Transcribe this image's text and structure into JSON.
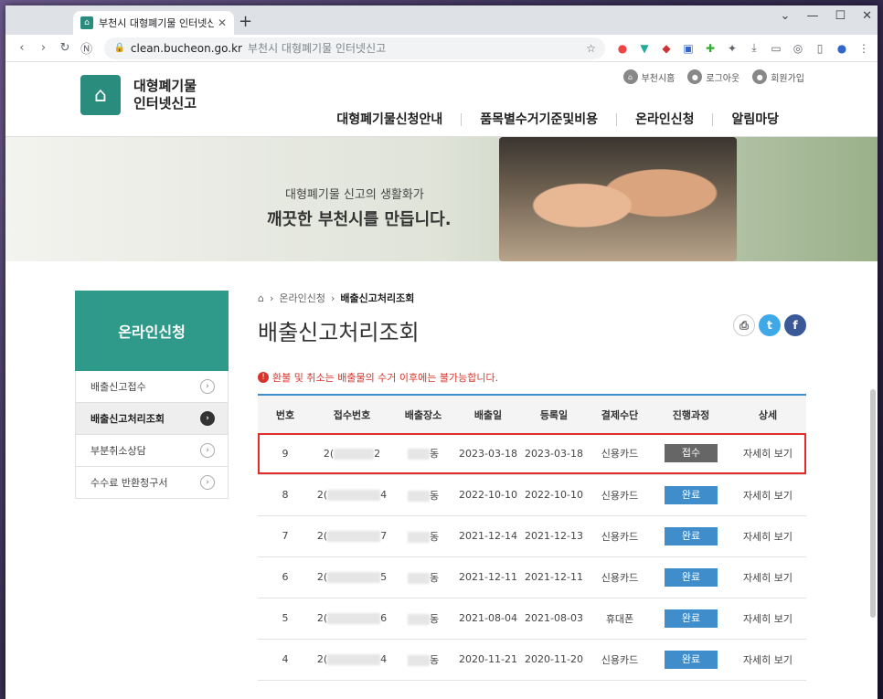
{
  "browser": {
    "tab_title": "부천시 대형폐기물 인터넷신고",
    "new_tab": "+",
    "url": "clean.bucheon.go.kr",
    "page_title": "부천시 대형폐기물 인터넷신고"
  },
  "site": {
    "logo_line1": "대형폐기물",
    "logo_line2": "인터넷신고",
    "util_links": [
      "부천시홈",
      "로그아웃",
      "회원가입"
    ],
    "gnb": [
      "대형폐기물신청안내",
      "품목별수거기준및비용",
      "온라인신청",
      "알림마당"
    ]
  },
  "banner": {
    "line1": "대형폐기물 신고의 생활화가",
    "line2": "깨끗한 부천시를 만듭니다."
  },
  "lnb": {
    "title": "온라인신청",
    "items": [
      "배출신고접수",
      "배출신고처리조회",
      "부분취소상담",
      "수수료 반환청구서"
    ]
  },
  "main": {
    "breadcrumb": [
      "온라인신청",
      "배출신고처리조회"
    ],
    "title": "배출신고처리조회",
    "notice": "환불 및 취소는 배출물의 수거 이후에는 불가능합니다.",
    "headers": [
      "번호",
      "접수번호",
      "배출장소",
      "배출일",
      "등록일",
      "결제수단",
      "진행과정",
      "상세"
    ],
    "rows": [
      {
        "no": "9",
        "rcpt_a": "2(",
        "rcpt_b": "2",
        "place": "동",
        "out": "2023-03-18",
        "reg": "2023-03-18",
        "pay": "신용카드",
        "status": "접수",
        "detail": "자세히 보기"
      },
      {
        "no": "8",
        "rcpt_a": "2(",
        "rcpt_b": "4",
        "place": "동",
        "out": "2022-10-10",
        "reg": "2022-10-10",
        "pay": "신용카드",
        "status": "완료",
        "detail": "자세히 보기"
      },
      {
        "no": "7",
        "rcpt_a": "2(",
        "rcpt_b": "7",
        "place": "동",
        "out": "2021-12-14",
        "reg": "2021-12-13",
        "pay": "신용카드",
        "status": "완료",
        "detail": "자세히 보기"
      },
      {
        "no": "6",
        "rcpt_a": "2(",
        "rcpt_b": "5",
        "place": "동",
        "out": "2021-12-11",
        "reg": "2021-12-11",
        "pay": "신용카드",
        "status": "완료",
        "detail": "자세히 보기"
      },
      {
        "no": "5",
        "rcpt_a": "2(",
        "rcpt_b": "6",
        "place": "동",
        "out": "2021-08-04",
        "reg": "2021-08-03",
        "pay": "휴대폰",
        "status": "완료",
        "detail": "자세히 보기"
      },
      {
        "no": "4",
        "rcpt_a": "2(",
        "rcpt_b": "4",
        "place": "동",
        "out": "2020-11-21",
        "reg": "2020-11-20",
        "pay": "신용카드",
        "status": "완료",
        "detail": "자세히 보기"
      }
    ]
  },
  "colors": {
    "accent": "#2f9a8a",
    "table_top": "#3f8dcb",
    "notice": "#d9342b",
    "highlight": "#e32b2b"
  }
}
